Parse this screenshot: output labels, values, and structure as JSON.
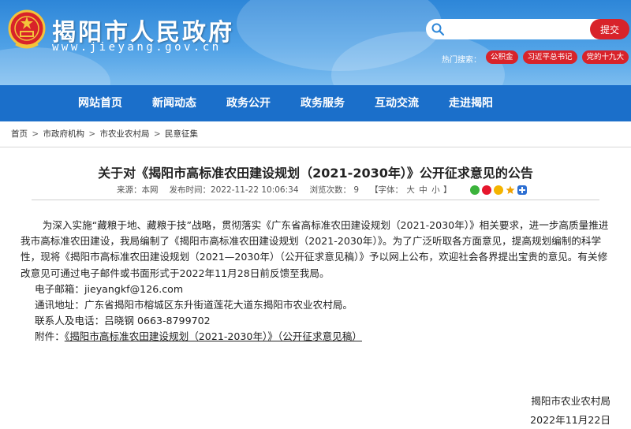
{
  "header": {
    "site_title": "揭阳市人民政府",
    "site_url": "www.jieyang.gov.cn",
    "search": {
      "placeholder": "",
      "button_label": "提交"
    },
    "hot_search": {
      "label": "热门搜索：",
      "tags": [
        "公积金",
        "习近平总书记",
        "党的十九大"
      ]
    }
  },
  "nav": {
    "items": [
      "网站首页",
      "新闻动态",
      "政务公开",
      "政务服务",
      "互动交流",
      "走进揭阳"
    ]
  },
  "breadcrumb": {
    "items": [
      "首页",
      "市政府机构",
      "市农业农村局",
      "民意征集"
    ],
    "separator": ">"
  },
  "article": {
    "title": "关于对《揭阳市高标准农田建设规划（2021-2030年）》公开征求意见的公告",
    "meta": {
      "source": "来源：本网",
      "publish_time": "发布时间：2022-11-22 10:06:34",
      "views": "浏览次数：  9",
      "font_label": "【字体：",
      "font_large": "大",
      "font_medium": "中",
      "font_small": "小",
      "font_end": "】"
    },
    "paragraph": "为深入实施“藏粮于地、藏粮于技”战略，贯彻落实《广东省高标准农田建设规划（2021-2030年）》相关要求，进一步高质量推进我市高标准农田建设，我局编制了《揭阳市高标准农田建设规划（2021-2030年）》。为了广泛听取各方面意见，提高规划编制的科学性，现将《揭阳市高标准农田建设规划（2021—2030年）（公开征求意见稿）》予以网上公布，欢迎社会各界提出宝贵的意见。有关修改意见可通过电子邮件或书面形式于2022年11月28日前反馈至我局。",
    "email": "电子邮箱：jieyangkf@126.com",
    "address": "通讯地址：广东省揭阳市榕城区东升街道莲花大道东揭阳市农业农村局。",
    "contact": "联系人及电话：吕晓钢   0663-8799702",
    "attachment_label": "附件：",
    "attachment_link": "《揭阳市高标准农田建设规划（2021-2030年）》（公开征求意见稿）",
    "signature_org": "揭阳市农业农村局",
    "signature_date": "2022年11月22日"
  },
  "colors": {
    "header_blue": "#2d86d8",
    "nav_blue": "#1b6fca",
    "accent_red": "#d8232a"
  },
  "icons": {
    "emblem": "national-emblem-icon",
    "search": "search-icon",
    "share": [
      "wechat-icon",
      "weibo-icon",
      "qzone-icon",
      "favorite-icon",
      "share-more-icon"
    ]
  }
}
